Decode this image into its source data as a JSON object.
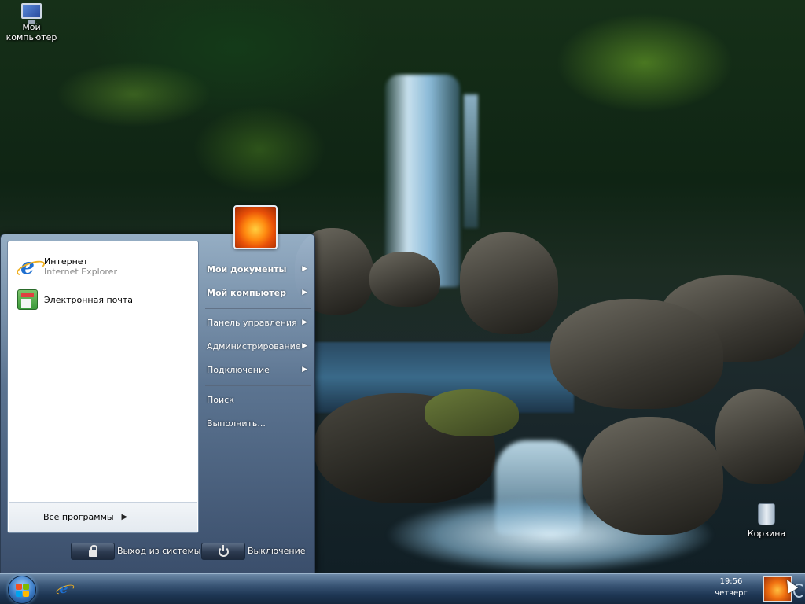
{
  "desktop": {
    "icons": {
      "my_computer": "Мой компьютер",
      "recycle_bin": "Корзина"
    }
  },
  "start_menu": {
    "pinned": [
      {
        "name": "Интернет",
        "subtitle": "Internet Explorer",
        "icon": "internet-explorer-icon"
      },
      {
        "name": "Электронная почта",
        "subtitle": "",
        "icon": "mail-icon"
      }
    ],
    "all_programs": "Все программы",
    "right_items": [
      {
        "label": "Мои документы",
        "bold": true,
        "submenu": true
      },
      {
        "label": "Мой компьютер",
        "bold": true,
        "submenu": true
      },
      {
        "label": "Панель управления",
        "bold": false,
        "submenu": true
      },
      {
        "label": "Администрирование",
        "bold": false,
        "submenu": true
      },
      {
        "label": "Подключение",
        "bold": false,
        "submenu": true
      },
      {
        "label": "Поиск",
        "bold": false,
        "submenu": false
      },
      {
        "label": "Выполнить...",
        "bold": false,
        "submenu": false
      }
    ],
    "logoff_label": "Выход из системы",
    "shutdown_label": "Выключение"
  },
  "taskbar": {
    "clock_time": "19:56",
    "clock_day": "четверг"
  },
  "colors": {
    "start_menu_top": "#a0b9d2",
    "start_menu_bottom": "#3c506e",
    "taskbar": "#1e3654",
    "ie_blue": "#1e6fd0"
  }
}
